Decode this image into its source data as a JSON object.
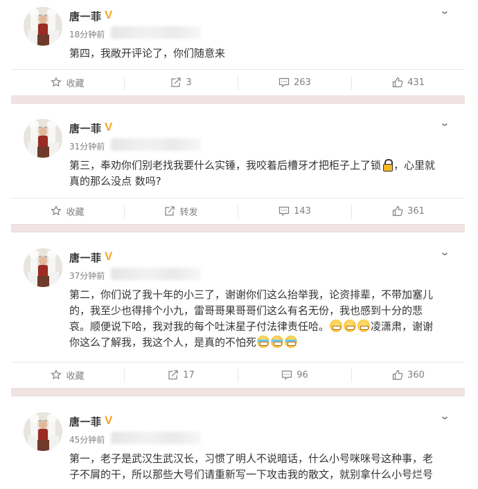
{
  "posts": [
    {
      "author": "唐一菲",
      "verified_badge": "V",
      "time": "18分钟前",
      "lines": [
        "第四，我敞开评论了，你们随意来"
      ],
      "actions": {
        "favorite": "收藏",
        "repost": "3",
        "comment": "263",
        "like": "431"
      }
    },
    {
      "author": "唐一菲",
      "verified_badge": "V",
      "time": "31分钟前",
      "lines": [
        "第三，奉劝你们别老找我要什么实锤，我咬着后槽牙才把柜子上了锁",
        "，心里就",
        "真的那么没点  数吗?"
      ],
      "actions": {
        "favorite": "收藏",
        "repost": "转发",
        "comment": "143",
        "like": "361"
      }
    },
    {
      "author": "唐一菲",
      "verified_badge": "V",
      "time": "37分钟前",
      "lines": [
        "第二，你们说了我十年的小三了，谢谢你们这么抬举我，论资排辈，不带加塞儿",
        "的，我至少也得排个小九，雷哥哥果哥哥们这么有名无份，我也感到十分的悲",
        "哀。顺便说下哈，我对我的每个吐沫星子付法律责任哈。",
        "凌潇肃，谢谢",
        "你这么了解我，我这个人，是真的不怕死"
      ],
      "actions": {
        "favorite": "收藏",
        "repost": "17",
        "comment": "96",
        "like": "360"
      }
    },
    {
      "author": "唐一菲",
      "verified_badge": "V",
      "time": "45分钟前",
      "lines": [
        "第一，老子是武汉生武汉长，习惯了明人不说暗话，什么小号咪咪号这种事，老",
        "子不屑的干，所以那些大号们请重新写一下攻击我的散文，就别拿什么小号烂号"
      ]
    }
  ],
  "icons": {
    "chevron": "chevron-down-icon",
    "favorite": "star-icon",
    "repost": "share-icon",
    "comment": "comment-icon",
    "like": "thumbs-up-icon"
  },
  "colors": {
    "separator_band": "#f0e3e3",
    "verified": "#f5a623",
    "muted_text": "#808080"
  }
}
